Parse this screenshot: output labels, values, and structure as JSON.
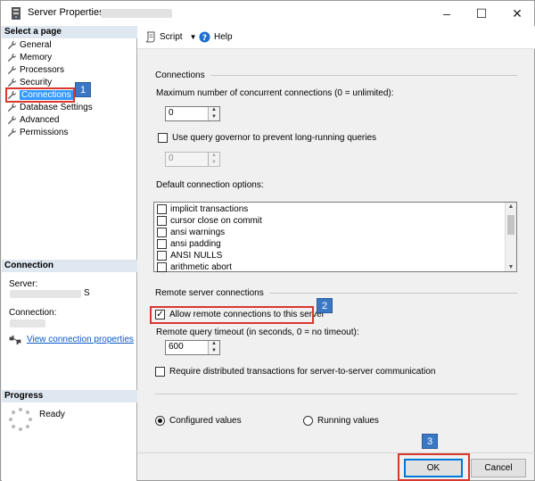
{
  "window": {
    "title": "Server Properties -",
    "controls": [
      "–",
      "☐",
      "✕"
    ]
  },
  "left_pane": {
    "select_page_heading": "Select a page",
    "pages": [
      "General",
      "Memory",
      "Processors",
      "Security",
      "Connections",
      "Database Settings",
      "Advanced",
      "Permissions"
    ],
    "selected_index": 4,
    "connection_heading": "Connection",
    "server_label": "Server:",
    "server_value_tail": "S",
    "connection_label": "Connection:",
    "view_connection_link": "View connection properties",
    "progress_heading": "Progress",
    "progress_status": "Ready"
  },
  "toolbar": {
    "script_label": "Script",
    "help_label": "Help"
  },
  "connections": {
    "group_label": "Connections",
    "max_connections_label": "Maximum number of concurrent connections (0 = unlimited):",
    "max_connections_value": "0",
    "query_governor_label": "Use query governor to prevent long-running queries",
    "query_governor_checked": false,
    "query_governor_value": "0",
    "default_options_label": "Default connection options:",
    "options": [
      {
        "label": "implicit transactions",
        "checked": false
      },
      {
        "label": "cursor close on commit",
        "checked": false
      },
      {
        "label": "ansi warnings",
        "checked": false
      },
      {
        "label": "ansi padding",
        "checked": false
      },
      {
        "label": "ANSI NULLS",
        "checked": false
      },
      {
        "label": "arithmetic abort",
        "checked": false
      }
    ]
  },
  "remote": {
    "group_label": "Remote server connections",
    "allow_remote_label": "Allow remote connections to this server",
    "allow_remote_checked": true,
    "timeout_label": "Remote query timeout (in seconds, 0 = no timeout):",
    "timeout_value": "600",
    "require_dtc_label": "Require distributed transactions for server-to-server communication",
    "require_dtc_checked": false
  },
  "values_mode": {
    "configured_label": "Configured values",
    "running_label": "Running values",
    "selected": "configured"
  },
  "buttons": {
    "ok_label": "OK",
    "cancel_label": "Cancel"
  },
  "callouts": [
    "1",
    "2",
    "3"
  ],
  "colors": {
    "callout_red": "#d9372c",
    "badge_blue": "#3a78c5",
    "selection_blue": "#3399ff",
    "link_blue": "#0b57c7"
  }
}
